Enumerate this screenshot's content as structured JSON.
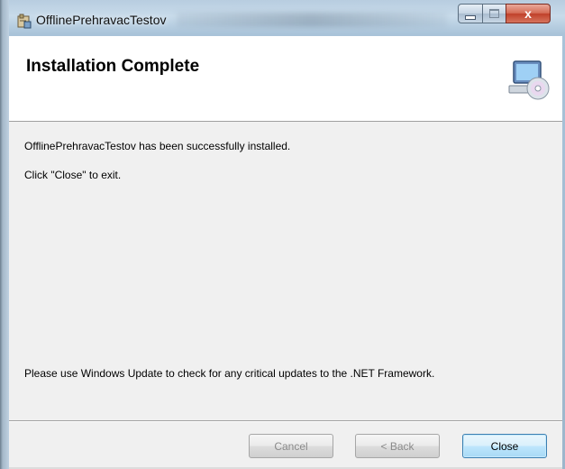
{
  "window": {
    "title": "OfflinePrehravacTestov",
    "close_glyph": "x"
  },
  "banner": {
    "title": "Installation Complete",
    "art_icon": "computer-cd-icon"
  },
  "content": {
    "success_message": "OfflinePrehravacTestov has been successfully installed.",
    "instruction": "Click \"Close\" to exit.",
    "update_note": "Please use Windows Update to check for any critical updates to the .NET Framework."
  },
  "buttons": {
    "cancel_label": "Cancel",
    "back_label": "< Back",
    "close_label": "Close"
  },
  "colors": {
    "close_accent": "#c0402a",
    "default_button_border": "#3c7fb1"
  }
}
